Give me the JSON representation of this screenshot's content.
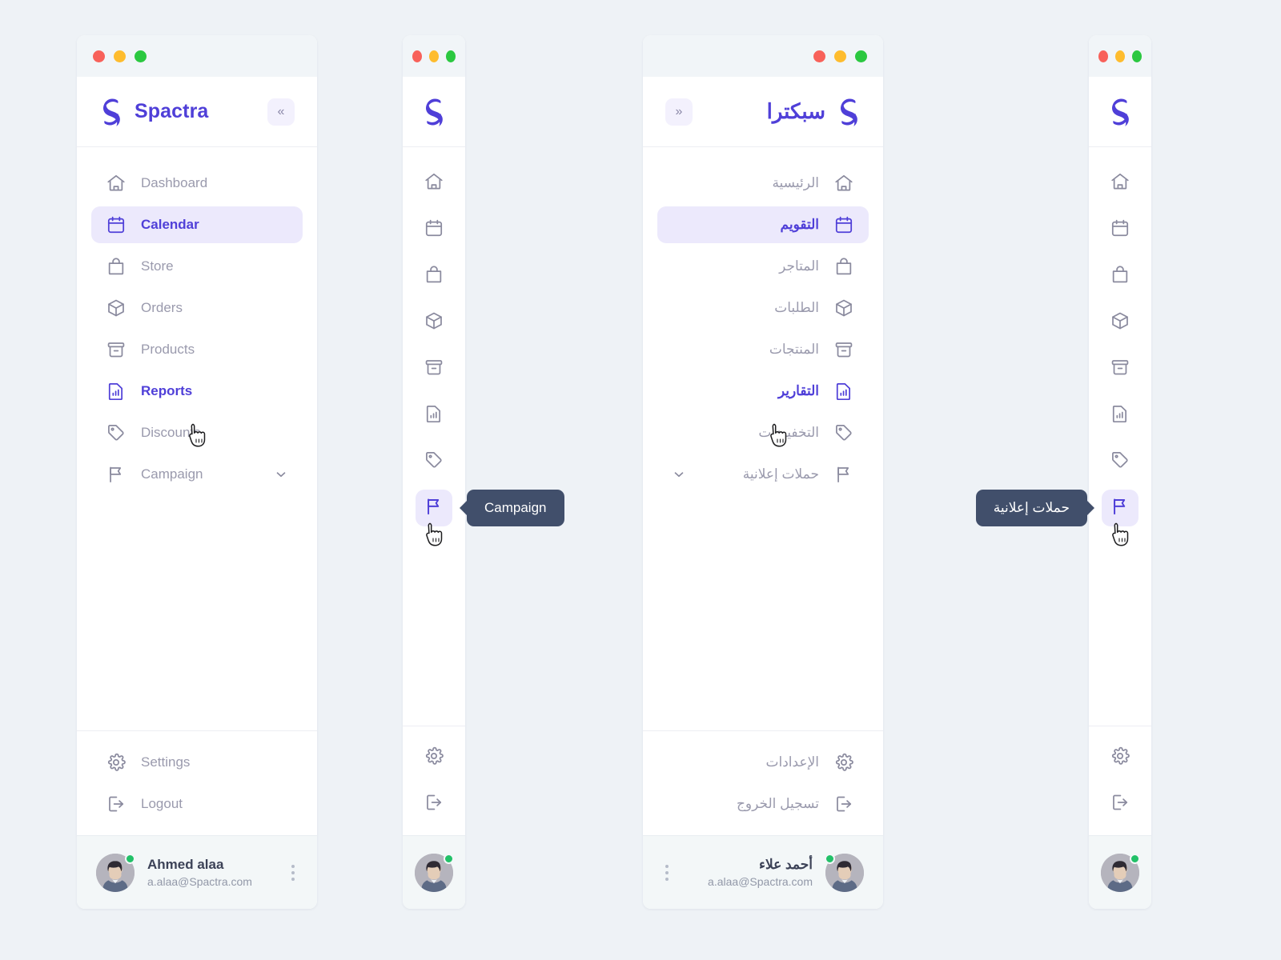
{
  "brand": {
    "name_en": "Spactra",
    "name_ar": "سبكترا",
    "logo_color": "#4f3fd8"
  },
  "window_controls": {
    "close_color": "#f8615a",
    "minimize_color": "#febc2e",
    "maximize_color": "#2bc840"
  },
  "collapse": {
    "collapse_label": "«",
    "expand_label": "»"
  },
  "colors": {
    "page_background": "#eef2f6",
    "accent": "#4f3fd8",
    "active_background": "#ece9fc",
    "muted_text": "#9a9aad",
    "tooltip_background": "#414f6b",
    "online_badge": "#22c168"
  },
  "nav_en": {
    "items": [
      {
        "label": "Dashboard",
        "icon": "home-icon",
        "state": "default"
      },
      {
        "label": "Calendar",
        "icon": "calendar-icon",
        "state": "active"
      },
      {
        "label": "Store",
        "icon": "bag-icon",
        "state": "default"
      },
      {
        "label": "Orders",
        "icon": "box-icon",
        "state": "default"
      },
      {
        "label": "Products",
        "icon": "archive-icon",
        "state": "default"
      },
      {
        "label": "Reports",
        "icon": "report-icon",
        "state": "hover"
      },
      {
        "label": "Discounts",
        "icon": "tag-icon",
        "state": "default"
      },
      {
        "label": "Campaign",
        "icon": "flag-icon",
        "state": "default",
        "expandable": true
      }
    ],
    "footer": [
      {
        "label": "Settings",
        "icon": "gear-icon"
      },
      {
        "label": "Logout",
        "icon": "logout-icon"
      }
    ]
  },
  "nav_ar": {
    "items": [
      {
        "label": "الرئيسية",
        "icon": "home-icon",
        "state": "default"
      },
      {
        "label": "التقويم",
        "icon": "calendar-icon",
        "state": "active"
      },
      {
        "label": "المتاجر",
        "icon": "bag-icon",
        "state": "default"
      },
      {
        "label": "الطلبات",
        "icon": "box-icon",
        "state": "default"
      },
      {
        "label": "المنتجات",
        "icon": "archive-icon",
        "state": "default"
      },
      {
        "label": "التقارير",
        "icon": "report-icon",
        "state": "hover"
      },
      {
        "label": "التخفيضات",
        "icon": "tag-icon",
        "state": "default"
      },
      {
        "label": "حملات إعلانية",
        "icon": "flag-icon",
        "state": "default",
        "expandable": true
      }
    ],
    "footer": [
      {
        "label": "الإعدادات",
        "icon": "gear-icon"
      },
      {
        "label": "تسجيل الخروج",
        "icon": "logout-icon"
      }
    ]
  },
  "profile_en": {
    "name": "Ahmed alaa",
    "email": "a.alaa@Spactra.com",
    "status": "online"
  },
  "profile_ar": {
    "name": "أحمد علاء",
    "email": "a.alaa@Spactra.com",
    "status": "online"
  },
  "tooltips": {
    "campaign_en": "Campaign",
    "campaign_ar": "حملات إعلانية"
  }
}
